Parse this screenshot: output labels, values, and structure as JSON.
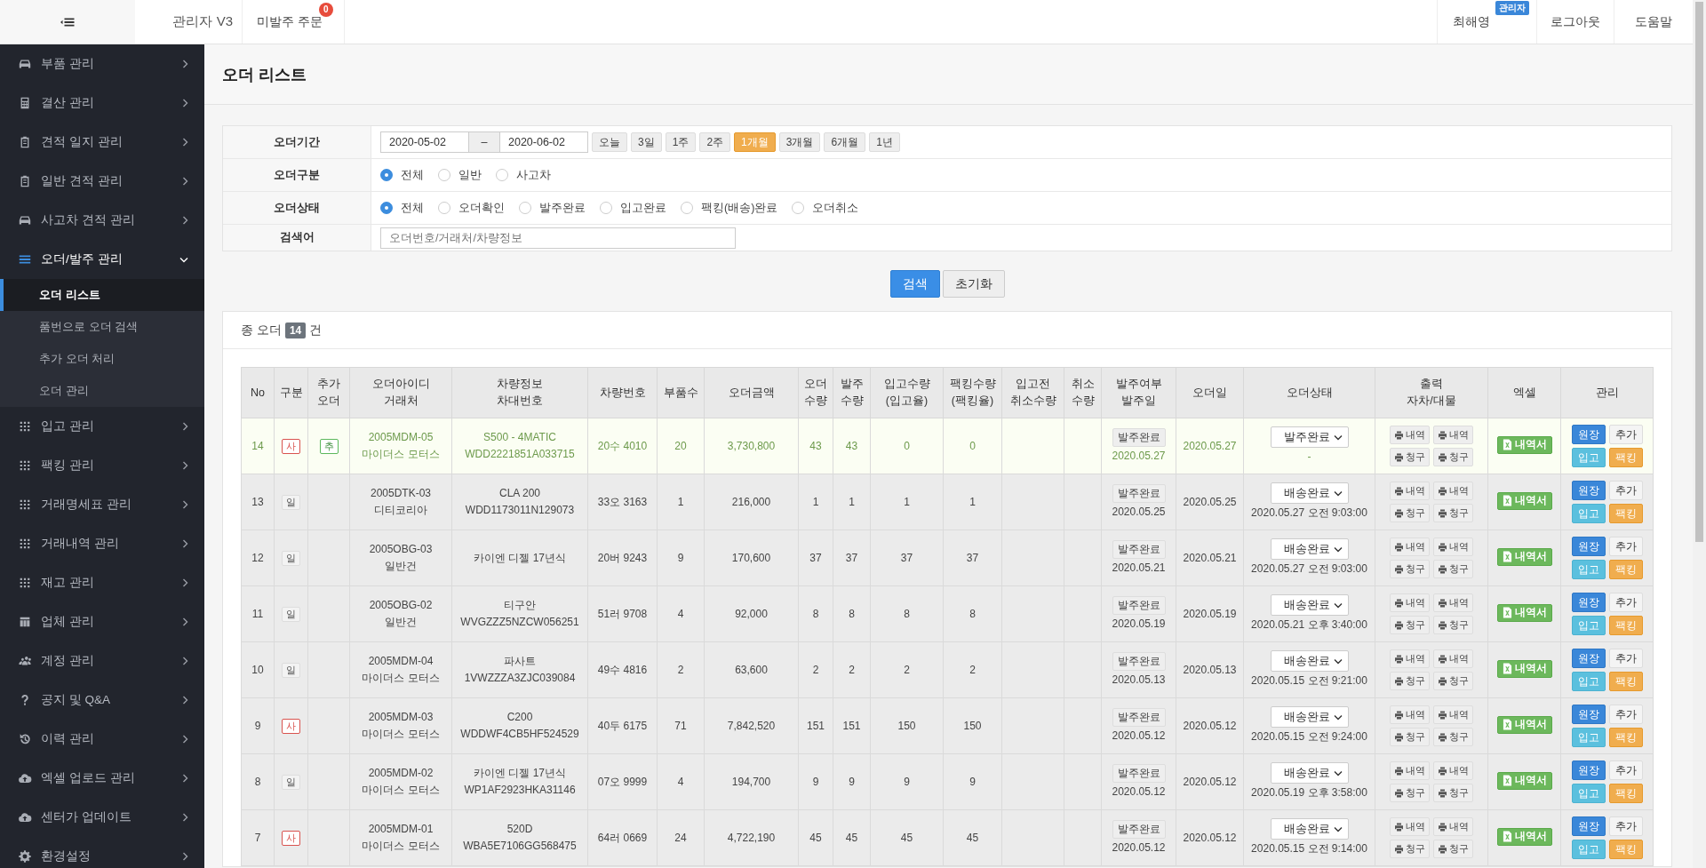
{
  "topbar": {
    "title": "관리자 V3",
    "tabs": [
      {
        "label": "미발주 주문",
        "badge": "0"
      }
    ],
    "user": {
      "name": "최해영",
      "role": "관리자"
    },
    "links": [
      "로그아웃",
      "도움말"
    ]
  },
  "sidebar": {
    "items": [
      {
        "label": "부품 관리",
        "expanded": false
      },
      {
        "label": "결산 관리",
        "expanded": false
      },
      {
        "label": "견적 일지 관리",
        "expanded": false
      },
      {
        "label": "일반 견적 관리",
        "expanded": false
      },
      {
        "label": "사고차 견적 관리",
        "expanded": false
      },
      {
        "label": "오더/발주 관리",
        "expanded": true,
        "children": [
          {
            "label": "오더 리스트",
            "selected": true
          },
          {
            "label": "품번으로 오더 검색",
            "selected": false
          },
          {
            "label": "추가 오더 처리",
            "selected": false
          },
          {
            "label": "오더 관리",
            "selected": false
          }
        ]
      },
      {
        "label": "입고 관리",
        "expanded": false
      },
      {
        "label": "팩킹 관리",
        "expanded": false
      },
      {
        "label": "거래명세표 관리",
        "expanded": false
      },
      {
        "label": "거래내역 관리",
        "expanded": false
      },
      {
        "label": "재고 관리",
        "expanded": false
      },
      {
        "label": "업체 관리",
        "expanded": false
      },
      {
        "label": "계정 관리",
        "expanded": false
      },
      {
        "label": "공지 및 Q&A",
        "expanded": false
      },
      {
        "label": "이력 관리",
        "expanded": false
      },
      {
        "label": "엑셀 업로드 관리",
        "expanded": false
      },
      {
        "label": "센터가 업데이트",
        "expanded": false
      },
      {
        "label": "환경설정",
        "expanded": false
      }
    ]
  },
  "page": {
    "title": "오더 리스트"
  },
  "filters": {
    "period": {
      "label": "오더기간",
      "from": "2020-05-02",
      "separator": "–",
      "to": "2020-06-02",
      "presets": [
        {
          "label": "오늘",
          "selected": false
        },
        {
          "label": "3일",
          "selected": false
        },
        {
          "label": "1주",
          "selected": false
        },
        {
          "label": "2주",
          "selected": false
        },
        {
          "label": "1개월",
          "selected": true
        },
        {
          "label": "3개월",
          "selected": false
        },
        {
          "label": "6개월",
          "selected": false
        },
        {
          "label": "1년",
          "selected": false
        }
      ]
    },
    "order_type": {
      "label": "오더구분",
      "options": [
        {
          "label": "전체",
          "selected": true
        },
        {
          "label": "일반",
          "selected": false
        },
        {
          "label": "사고차",
          "selected": false
        }
      ]
    },
    "order_status": {
      "label": "오더상태",
      "options": [
        {
          "label": "전체",
          "selected": true
        },
        {
          "label": "오더확인",
          "selected": false
        },
        {
          "label": "발주완료",
          "selected": false
        },
        {
          "label": "입고완료",
          "selected": false
        },
        {
          "label": "팩킹(배송)완료",
          "selected": false
        },
        {
          "label": "오더취소",
          "selected": false
        }
      ]
    },
    "keyword": {
      "label": "검색어",
      "placeholder": "오더번호/거래처/차량정보"
    }
  },
  "actions": [
    {
      "label": "검색",
      "kind": "primary"
    },
    {
      "label": "초기화",
      "kind": "default"
    }
  ],
  "summary": {
    "prefix": "종 오더",
    "count": "14",
    "suffix": "건"
  },
  "table": {
    "columns": [
      [
        "No"
      ],
      [
        "구분"
      ],
      [
        "추가",
        "오더"
      ],
      [
        "오더아이디",
        "거래처"
      ],
      [
        "차량정보",
        "차대번호"
      ],
      [
        "차량번호"
      ],
      [
        "부품수"
      ],
      [
        "오더금액"
      ],
      [
        "오더",
        "수량"
      ],
      [
        "발주",
        "수량"
      ],
      [
        "입고수량",
        "(입고율)"
      ],
      [
        "팩킹수량",
        "(팩킹율)"
      ],
      [
        "입고전",
        "취소수량"
      ],
      [
        "취소",
        "수량"
      ],
      [
        "발주여부",
        "발주일"
      ],
      [
        "오더일"
      ],
      [
        "오더상태"
      ],
      [
        "출력",
        "자차/대물"
      ],
      [
        "엑셀"
      ],
      [
        "관리"
      ]
    ],
    "rows": [
      {
        "no": "14",
        "highlighted": true,
        "type": {
          "kind": "accident",
          "label": "사"
        },
        "extra": "추",
        "order_id": "2005MDM-05",
        "vendor": "마이더스 모터스",
        "car_model": "S500 - 4MATIC",
        "chassis": "WDD2221851A033715",
        "plate": "20수 4010",
        "parts": "20",
        "amount": "3,730,800",
        "order_qty": "43",
        "po_qty": "43",
        "in_qty": "0",
        "pack_qty": "0",
        "po_status": "발주완료",
        "po_date": "2020.05.27",
        "order_date": "2020.05.27",
        "status": "발주완료",
        "status_time": "-",
        "print_buttons": [
          "내역",
          "내역",
          "청구",
          "청구"
        ],
        "excel_button": "내역서",
        "manage_buttons": [
          "원장",
          "추가",
          "입고",
          "팩킹"
        ]
      },
      {
        "no": "13",
        "highlighted": false,
        "type": {
          "kind": "normal",
          "label": "일"
        },
        "order_id": "2005DTK-03",
        "vendor": "디티코리아",
        "car_model": "CLA 200",
        "chassis": "WDD1173011N129073",
        "plate": "33오 3163",
        "parts": "1",
        "amount": "216,000",
        "order_qty": "1",
        "po_qty": "1",
        "in_qty": "1",
        "pack_qty": "1",
        "po_status": "발주완료",
        "po_date": "2020.05.25",
        "order_date": "2020.05.25",
        "status": "배송완료",
        "status_time": "2020.05.27 오전 9:03:00",
        "print_buttons": [
          "내역",
          "내역",
          "청구",
          "청구"
        ],
        "excel_button": "내역서",
        "manage_buttons": [
          "원장",
          "추가",
          "입고",
          "팩킹"
        ]
      },
      {
        "no": "12",
        "highlighted": false,
        "type": {
          "kind": "normal",
          "label": "일"
        },
        "order_id": "2005OBG-03",
        "vendor": "일반건",
        "car_model": "카이엔 디젤 17년식",
        "plate": "20버 9243",
        "parts": "9",
        "amount": "170,600",
        "order_qty": "37",
        "po_qty": "37",
        "in_qty": "37",
        "pack_qty": "37",
        "po_status": "발주완료",
        "po_date": "2020.05.21",
        "order_date": "2020.05.21",
        "status": "배송완료",
        "status_time": "2020.05.27 오전 9:03:00",
        "print_buttons": [
          "내역",
          "내역",
          "청구",
          "청구"
        ],
        "excel_button": "내역서",
        "manage_buttons": [
          "원장",
          "추가",
          "입고",
          "팩킹"
        ]
      },
      {
        "no": "11",
        "highlighted": false,
        "type": {
          "kind": "normal",
          "label": "일"
        },
        "order_id": "2005OBG-02",
        "vendor": "일반건",
        "car_model": "티구안",
        "chassis": "WVGZZZ5NZCW056251",
        "plate": "51러 9708",
        "parts": "4",
        "amount": "92,000",
        "order_qty": "8",
        "po_qty": "8",
        "in_qty": "8",
        "pack_qty": "8",
        "po_status": "발주완료",
        "po_date": "2020.05.19",
        "order_date": "2020.05.19",
        "status": "배송완료",
        "status_time": "2020.05.21 오후 3:40:00",
        "print_buttons": [
          "내역",
          "내역",
          "청구",
          "청구"
        ],
        "excel_button": "내역서",
        "manage_buttons": [
          "원장",
          "추가",
          "입고",
          "팩킹"
        ]
      },
      {
        "no": "10",
        "highlighted": false,
        "type": {
          "kind": "normal",
          "label": "일"
        },
        "order_id": "2005MDM-04",
        "vendor": "마이더스 모터스",
        "car_model": "파사트",
        "chassis": "1VWZZZA3ZJC039084",
        "plate": "49수 4816",
        "parts": "2",
        "amount": "63,600",
        "order_qty": "2",
        "po_qty": "2",
        "in_qty": "2",
        "pack_qty": "2",
        "po_status": "발주완료",
        "po_date": "2020.05.13",
        "order_date": "2020.05.13",
        "status": "배송완료",
        "status_time": "2020.05.15 오전 9:21:00",
        "print_buttons": [
          "내역",
          "내역",
          "청구",
          "청구"
        ],
        "excel_button": "내역서",
        "manage_buttons": [
          "원장",
          "추가",
          "입고",
          "팩킹"
        ]
      },
      {
        "no": "9",
        "highlighted": false,
        "type": {
          "kind": "accident",
          "label": "사"
        },
        "order_id": "2005MDM-03",
        "vendor": "마이더스 모터스",
        "car_model": "C200",
        "chassis": "WDDWF4CB5HF524529",
        "plate": "40두 6175",
        "parts": "71",
        "amount": "7,842,520",
        "order_qty": "151",
        "po_qty": "151",
        "in_qty": "150",
        "pack_qty": "150",
        "po_status": "발주완료",
        "po_date": "2020.05.12",
        "order_date": "2020.05.12",
        "status": "배송완료",
        "status_time": "2020.05.15 오전 9:24:00",
        "print_buttons": [
          "내역",
          "내역",
          "청구",
          "청구"
        ],
        "excel_button": "내역서",
        "manage_buttons": [
          "원장",
          "추가",
          "입고",
          "팩킹"
        ]
      },
      {
        "no": "8",
        "highlighted": false,
        "type": {
          "kind": "normal",
          "label": "일"
        },
        "order_id": "2005MDM-02",
        "vendor": "마이더스 모터스",
        "car_model": "카이엔 디젤 17년식",
        "chassis": "WP1AF2923HKA31146",
        "plate": "07오 9999",
        "parts": "4",
        "amount": "194,700",
        "order_qty": "9",
        "po_qty": "9",
        "in_qty": "9",
        "pack_qty": "9",
        "po_status": "발주완료",
        "po_date": "2020.05.12",
        "order_date": "2020.05.12",
        "status": "배송완료",
        "status_time": "2020.05.19 오후 3:58:00",
        "print_buttons": [
          "내역",
          "내역",
          "청구",
          "청구"
        ],
        "excel_button": "내역서",
        "manage_buttons": [
          "원장",
          "추가",
          "입고",
          "팩킹"
        ]
      },
      {
        "no": "7",
        "highlighted": false,
        "type": {
          "kind": "accident",
          "label": "사"
        },
        "order_id": "2005MDM-01",
        "vendor": "마이더스 모터스",
        "car_model": "520D",
        "chassis": "WBA5E7106GG568475",
        "plate": "64러 0669",
        "parts": "24",
        "amount": "4,722,190",
        "order_qty": "45",
        "po_qty": "45",
        "in_qty": "45",
        "pack_qty": "45",
        "po_status": "발주완료",
        "po_date": "2020.05.12",
        "order_date": "2020.05.12",
        "status": "배송완료",
        "status_time": "2020.05.15 오전 9:14:00",
        "print_buttons": [
          "내역",
          "내역",
          "청구",
          "청구"
        ],
        "excel_button": "내역서",
        "manage_buttons": [
          "원장",
          "추가",
          "입고",
          "팩킹"
        ]
      }
    ]
  }
}
